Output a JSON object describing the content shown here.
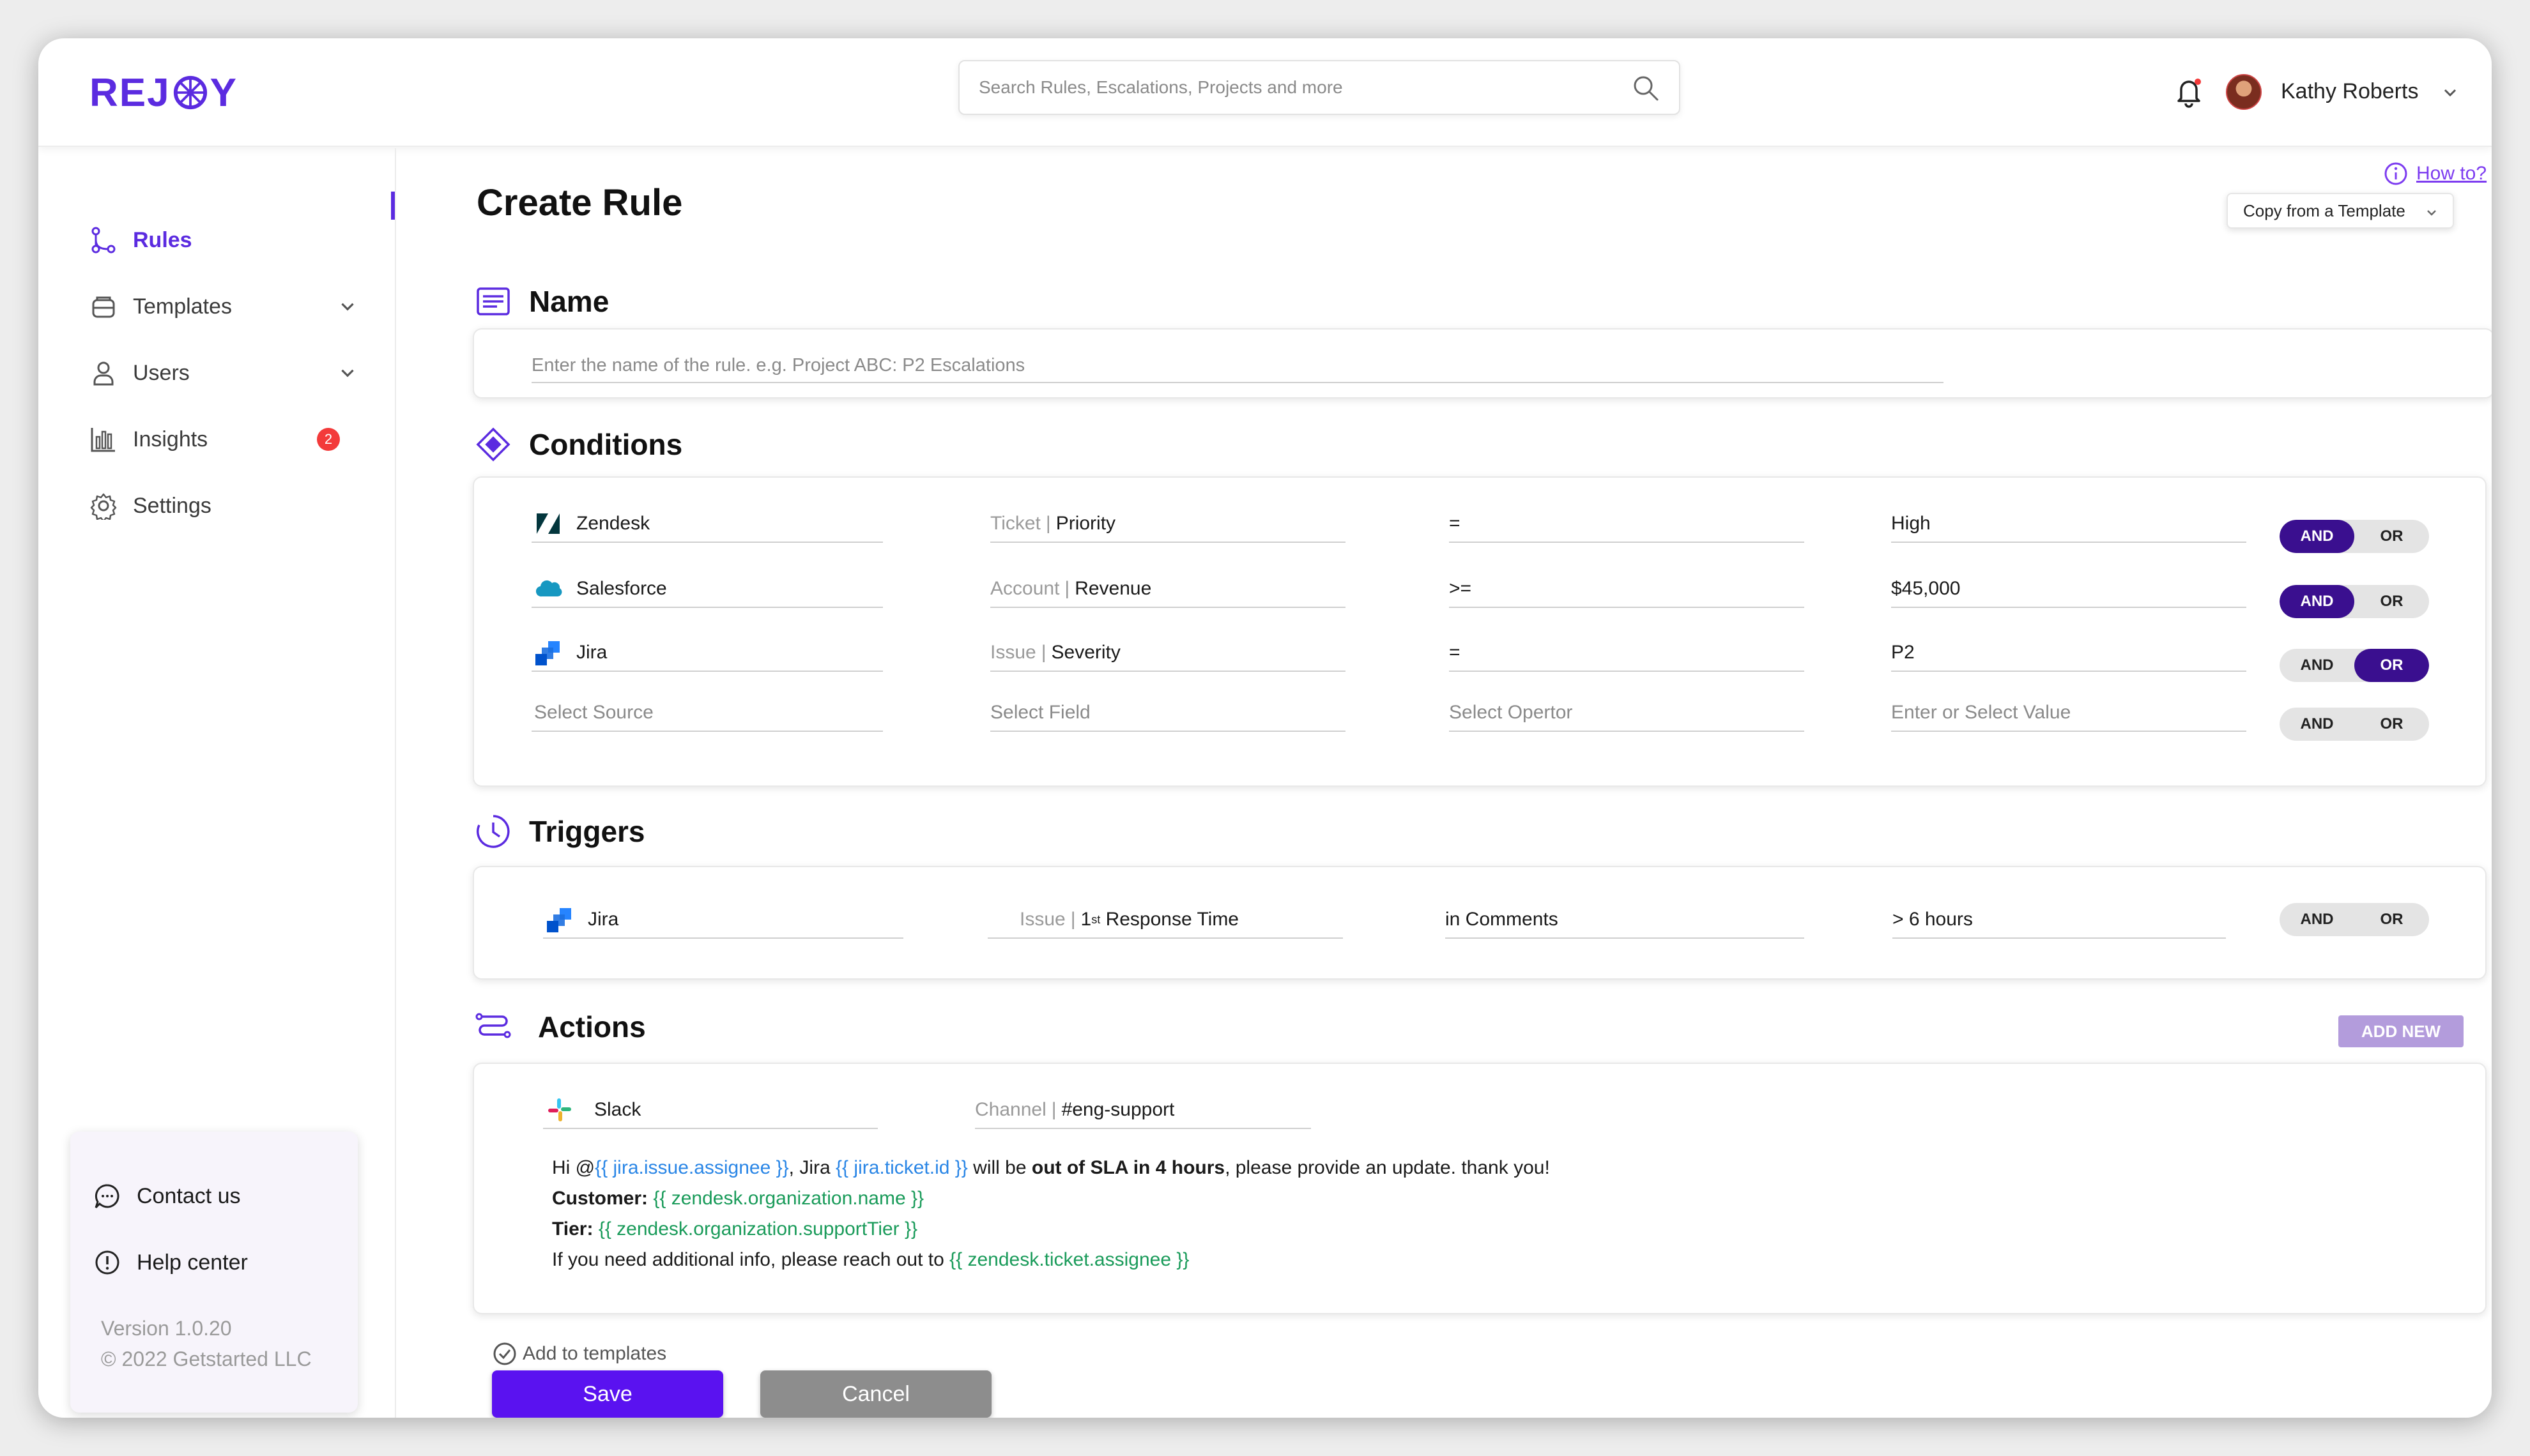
{
  "app": {
    "logo_left": "REJ",
    "logo_right": "Y"
  },
  "header": {
    "search_placeholder": "Search Rules, Escalations, Projects and more",
    "user_name": "Kathy Roberts"
  },
  "sidebar": {
    "items": [
      {
        "label": "Rules",
        "icon": "rules-icon",
        "active": true
      },
      {
        "label": "Templates",
        "icon": "templates-icon"
      },
      {
        "label": "Users",
        "icon": "users-icon"
      },
      {
        "label": "Insights",
        "icon": "insights-icon",
        "badge": "2"
      },
      {
        "label": "Settings",
        "icon": "settings-icon"
      }
    ],
    "help": {
      "contact": "Contact us",
      "help_center": "Help center",
      "version": "Version 1.0.20",
      "copyright": "© 2022 Getstarted LLC"
    }
  },
  "main": {
    "title": "Create Rule",
    "how_to": "How to?",
    "copy_template": "Copy from a Template",
    "name": {
      "heading": "Name",
      "placeholder": "Enter the name of the rule. e.g. Project ABC: P2 Escalations"
    },
    "conditions": {
      "heading": "Conditions",
      "rows": [
        {
          "source": "Zendesk",
          "field_prefix": "Ticket",
          "field": "Priority",
          "operator": "=",
          "value": "High",
          "toggle": "AND"
        },
        {
          "source": "Salesforce",
          "field_prefix": "Account",
          "field": "Revenue",
          "operator": ">=",
          "value": "$45,000",
          "toggle": "AND"
        },
        {
          "source": "Jira",
          "field_prefix": "Issue",
          "field": "Severity",
          "operator": "=",
          "value": "P2",
          "toggle": "OR"
        }
      ],
      "empty_row": {
        "source": "Select Source",
        "field": "Select Field",
        "operator": "Select Opertor",
        "value": "Enter or Select Value"
      },
      "and_label": "AND",
      "or_label": "OR"
    },
    "triggers": {
      "heading": "Triggers",
      "source": "Jira",
      "field_prefix": "Issue",
      "field_num": "1",
      "field_sup": "st",
      "field": "Response Time",
      "operator": "in Comments",
      "value": "> 6 hours"
    },
    "actions": {
      "heading": "Actions",
      "add_new": "ADD NEW",
      "source": "Slack",
      "channel_prefix": "Channel",
      "channel": "#eng-support",
      "message": {
        "l1_a": "Hi @",
        "l1_var1": "{{ jira.issue.assignee }}",
        "l1_b": ", Jira ",
        "l1_var2": "{{ jira.ticket.id }}",
        "l1_c": " will be ",
        "l1_bold": "out of SLA in 4 hours",
        "l1_d": ", please provide an update. thank you!",
        "l2_label": "Customer:",
        "l2_var": "{{ zendesk.organization.name }}",
        "l3_label": "Tier:",
        "l3_var": "{{ zendesk.organization.supportTier }}",
        "l4_a": "If you need additional info, please reach out to ",
        "l4_var": "{{ zendesk.ticket.assignee }}"
      }
    },
    "footer": {
      "add_to_templates": "Add to templates",
      "save": "Save",
      "cancel": "Cancel"
    }
  },
  "colors": {
    "brand": "#5b2be0",
    "toggle_active": "#3a0f8f",
    "save": "#5a12f0",
    "badge": "#f33a3a"
  }
}
